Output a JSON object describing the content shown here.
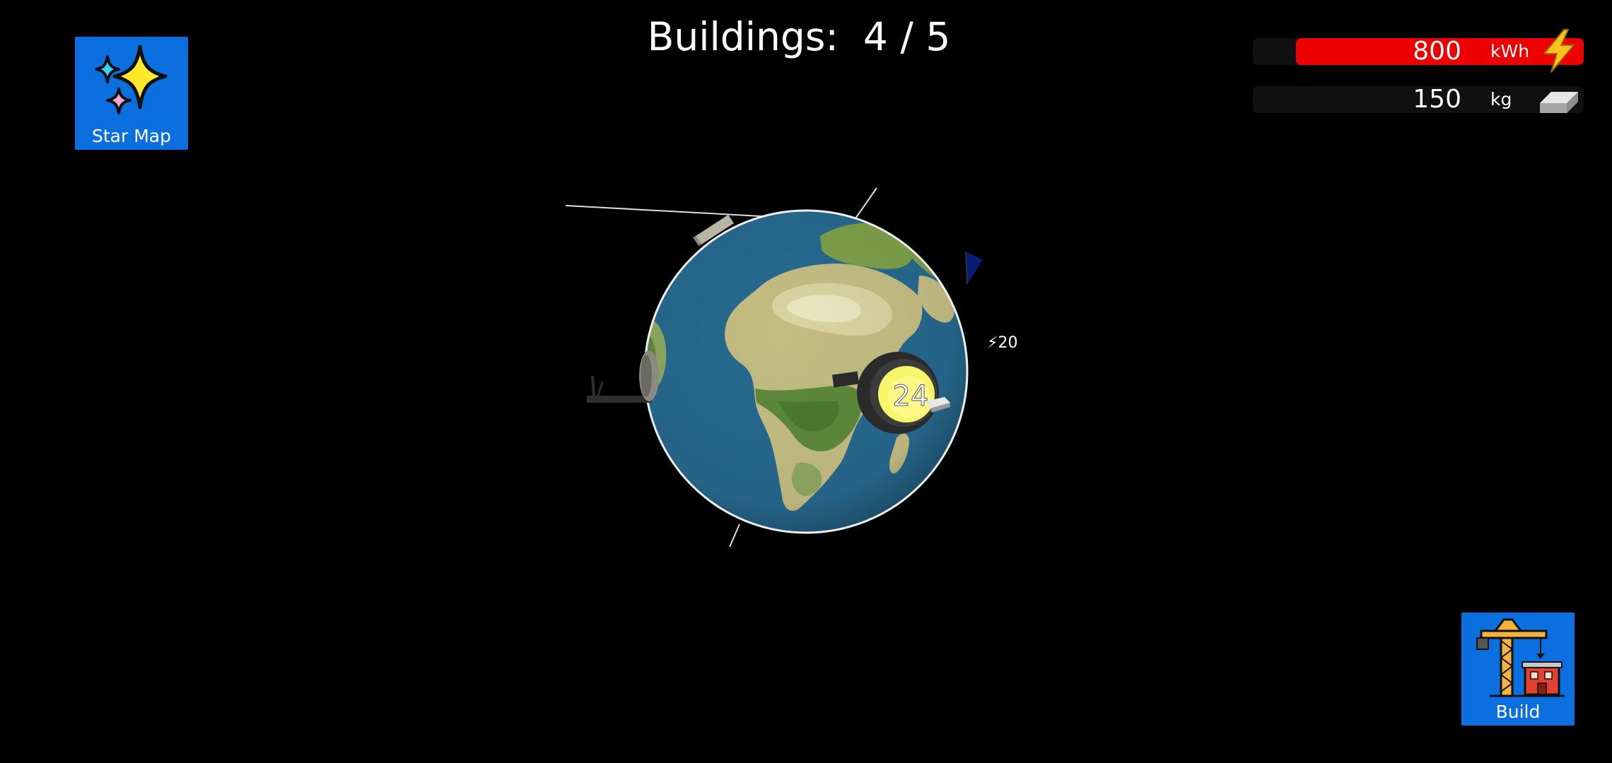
{
  "hud": {
    "title": "Buildings:  4 / 5",
    "star_map_label": "Star Map",
    "build_label": "Build"
  },
  "resources": {
    "energy": {
      "value": "800",
      "unit": "kWh",
      "icon": "lightning-icon",
      "fill_fraction": 0.87,
      "color": "#ee0000"
    },
    "metal": {
      "value": "150",
      "unit": "kg",
      "icon": "metal-ingot-icon",
      "fill_fraction": 0.0
    }
  },
  "planet": {
    "production_badge": "⚡20",
    "sun_building_count": "24"
  },
  "colors": {
    "button_blue": "#0b6fe0",
    "ocean": "#2a6f9a",
    "land": "#c9c38a",
    "forest": "#5e8a3a"
  }
}
